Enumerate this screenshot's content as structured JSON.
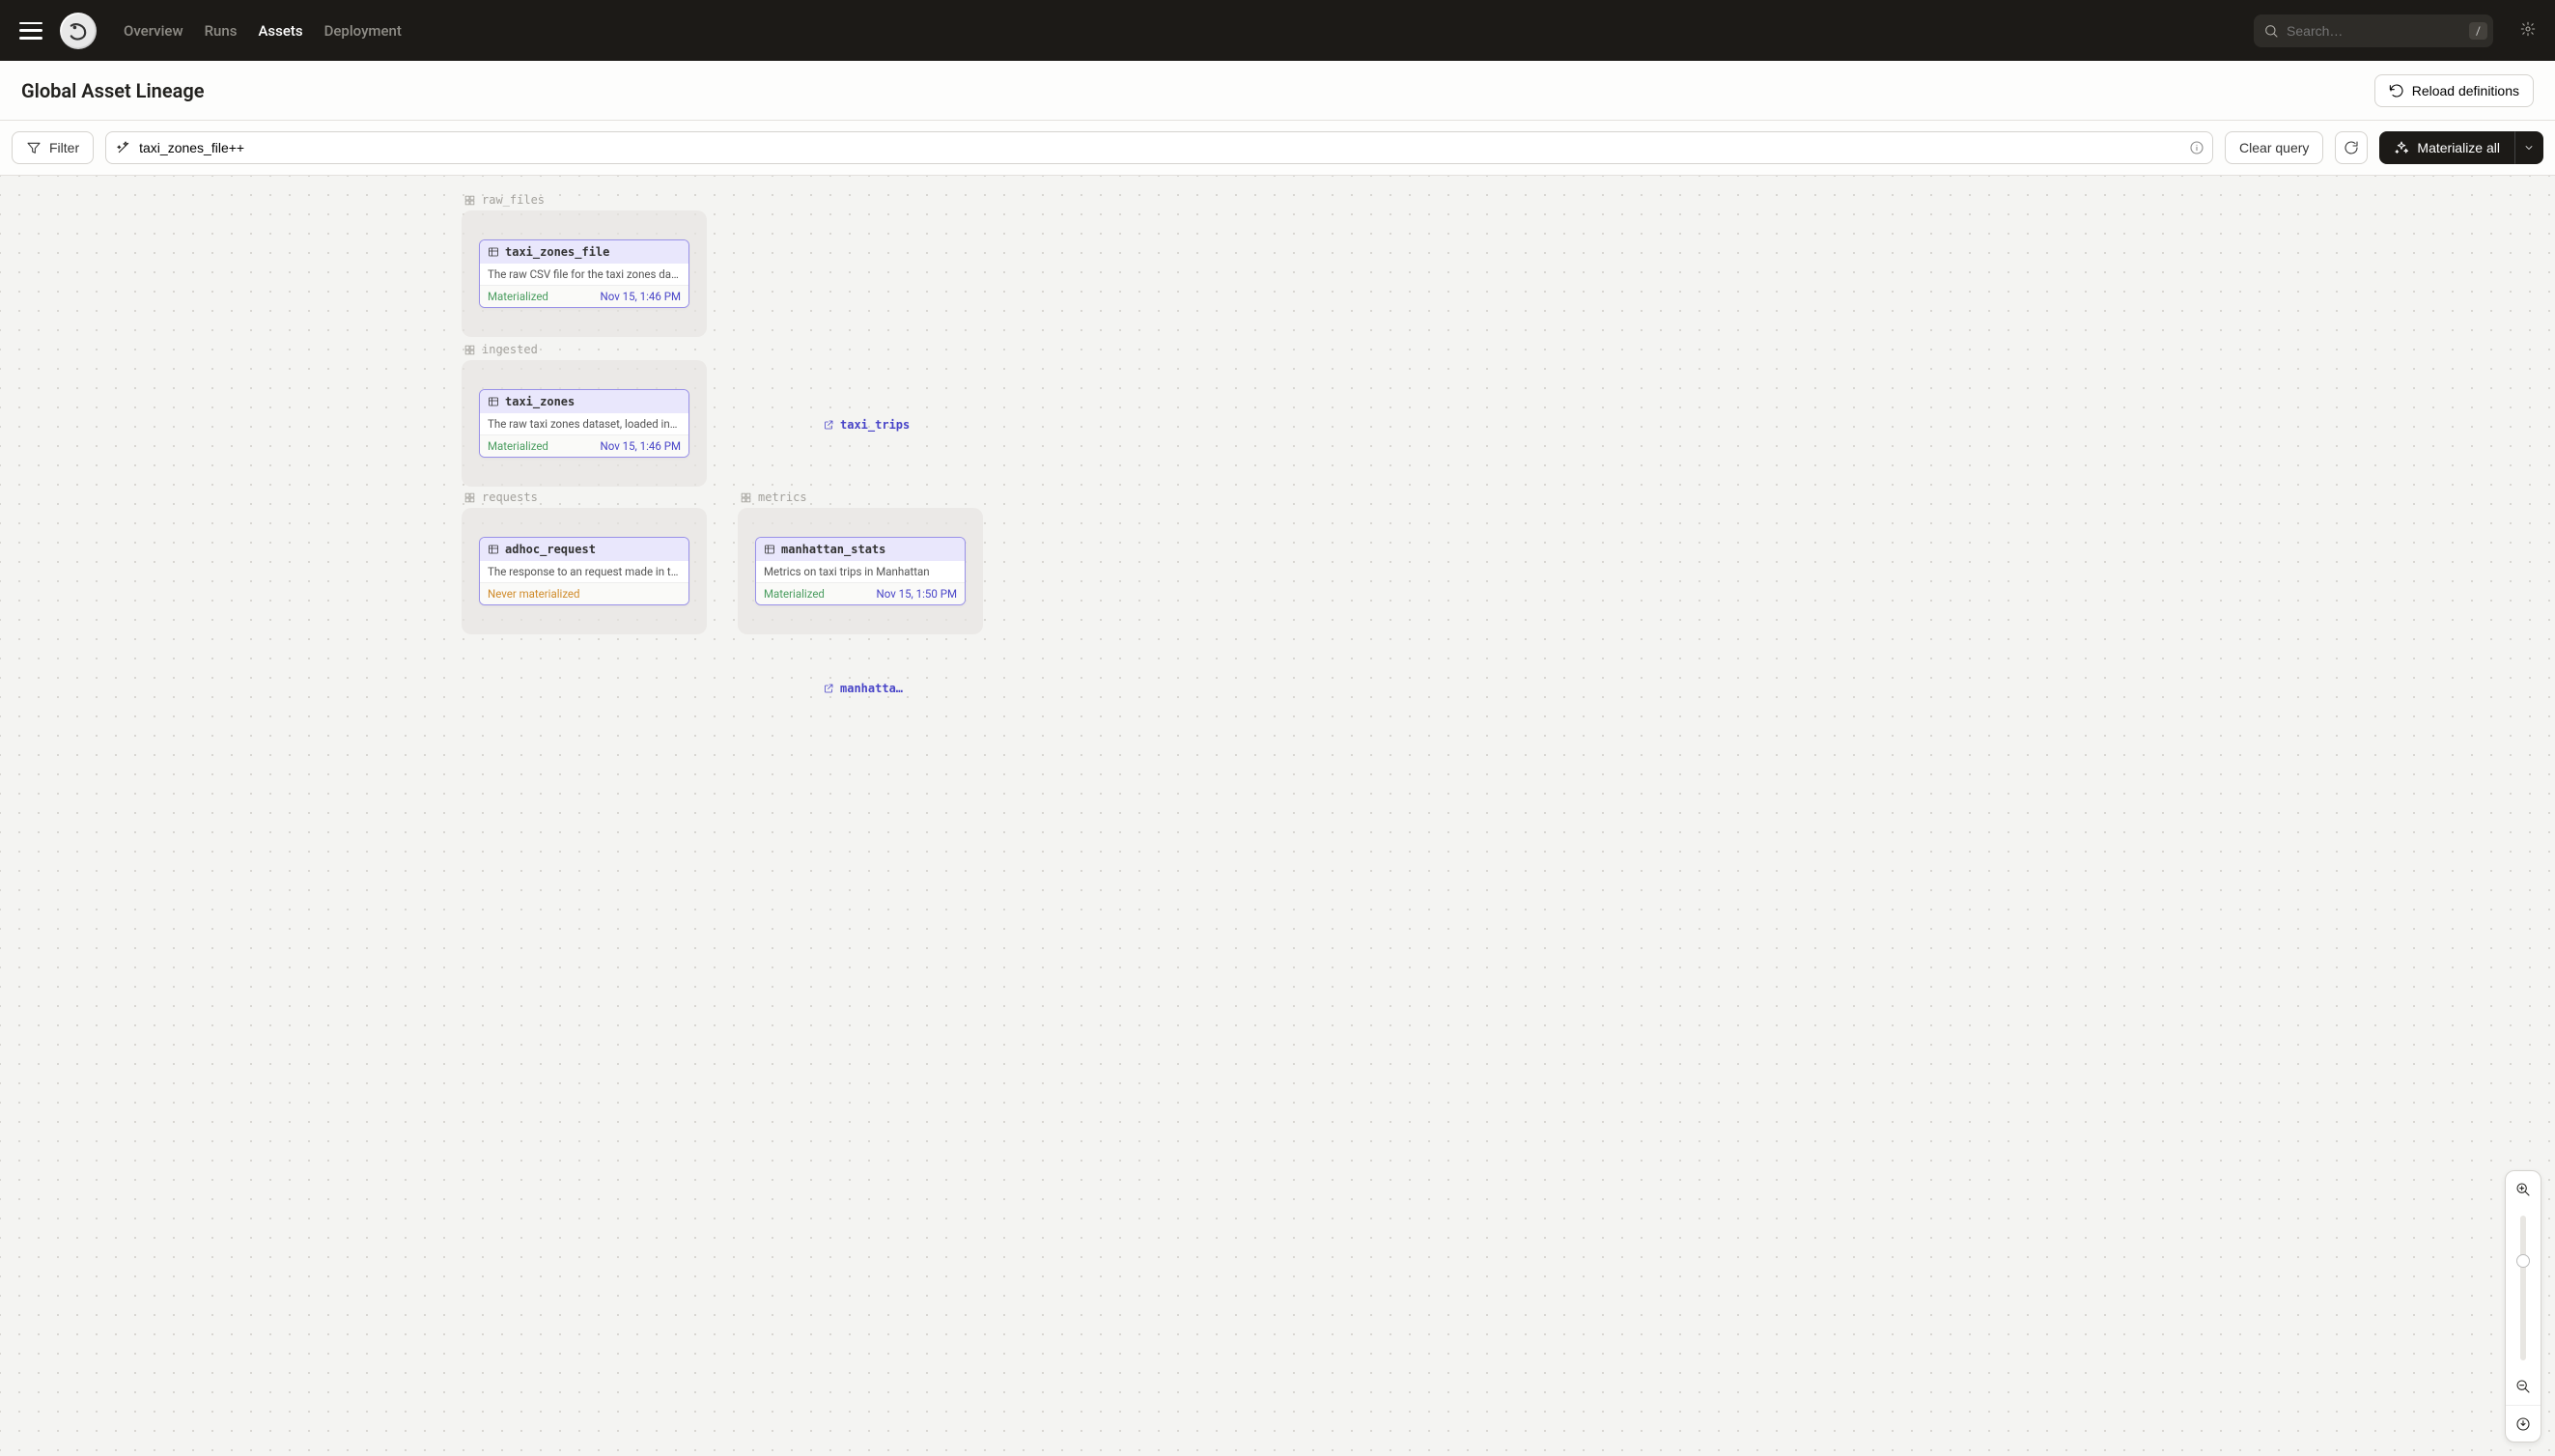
{
  "nav": {
    "links": [
      "Overview",
      "Runs",
      "Assets",
      "Deployment"
    ],
    "active": "Assets",
    "search_placeholder": "Search…",
    "search_hotkey": "/"
  },
  "page": {
    "title": "Global Asset Lineage",
    "reload_label": "Reload definitions"
  },
  "toolbar": {
    "filter_label": "Filter",
    "query_value": "taxi_zones_file++",
    "clear_label": "Clear query",
    "materialize_label": "Materialize all"
  },
  "groups": {
    "raw_files": {
      "label": "raw_files"
    },
    "ingested": {
      "label": "ingested"
    },
    "requests": {
      "label": "requests"
    },
    "metrics": {
      "label": "metrics"
    }
  },
  "nodes": {
    "taxi_zones_file": {
      "name": "taxi_zones_file",
      "desc": "The raw CSV file for the taxi zones dat…",
      "status": "Materialized",
      "time": "Nov 15, 1:46 PM"
    },
    "taxi_zones": {
      "name": "taxi_zones",
      "desc": "The raw taxi zones dataset, loaded int…",
      "status": "Materialized",
      "time": "Nov 15, 1:46 PM"
    },
    "adhoc_request": {
      "name": "adhoc_request",
      "desc": "The response to an request made in th…",
      "status": "Never materialized",
      "time": ""
    },
    "manhattan_stats": {
      "name": "manhattan_stats",
      "desc": "Metrics on taxi trips in Manhattan",
      "status": "Materialized",
      "time": "Nov 15, 1:50 PM"
    }
  },
  "external": {
    "taxi_trips": "taxi_trips",
    "manhattan": "manhattan…"
  }
}
